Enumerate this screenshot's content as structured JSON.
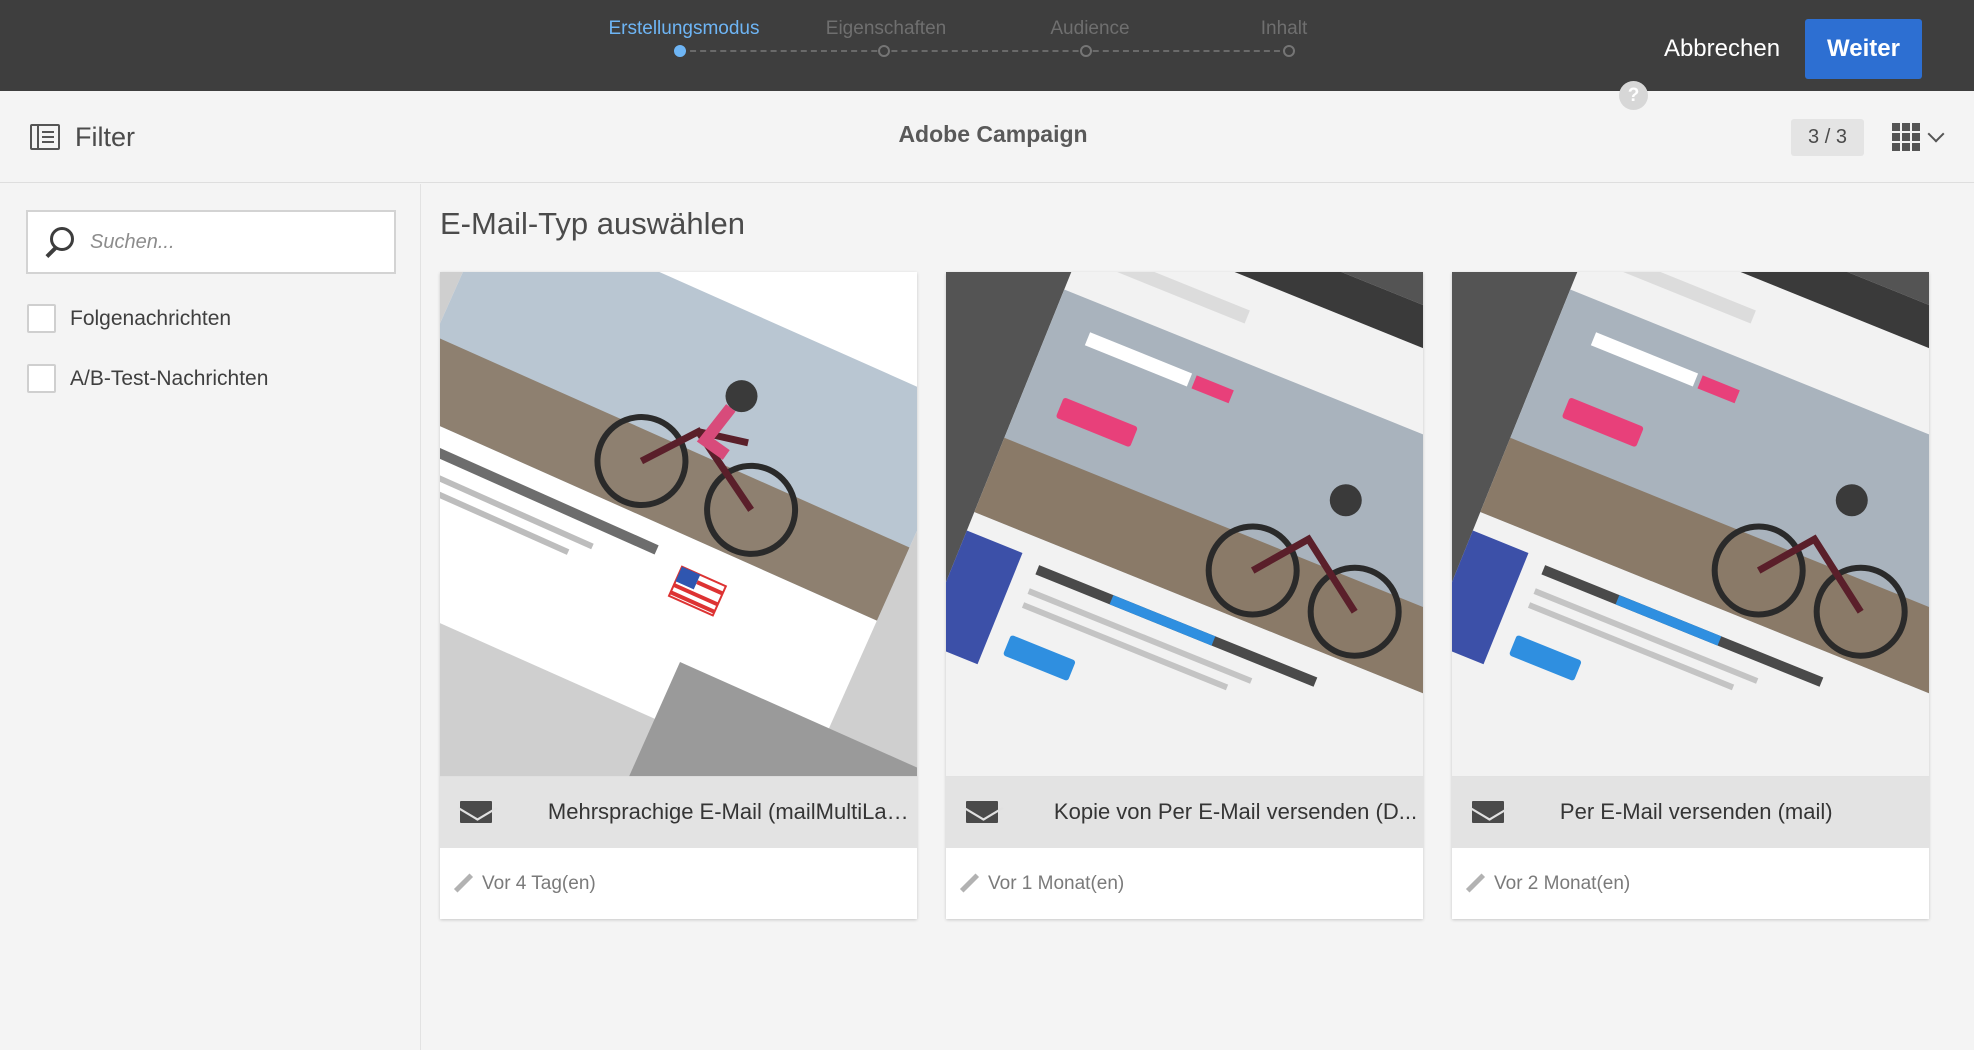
{
  "wizard": {
    "steps": [
      {
        "label": "Erstellungsmodus",
        "active": true
      },
      {
        "label": "Eigenschaften",
        "active": false
      },
      {
        "label": "Audience",
        "active": false
      },
      {
        "label": "Inhalt",
        "active": false
      }
    ],
    "cancel_label": "Abbrechen",
    "next_label": "Weiter",
    "help_label": "?"
  },
  "header": {
    "filter_label": "Filter",
    "app_title": "Adobe Campaign",
    "page_count": "3 / 3",
    "view_icon": "grid-view-icon"
  },
  "sidebar": {
    "search_placeholder": "Suchen...",
    "filters": [
      {
        "label": "Folgenachrichten",
        "checked": false
      },
      {
        "label": "A/B-Test-Nachrichten",
        "checked": false
      }
    ]
  },
  "main": {
    "title": "E-Mail-Typ auswählen",
    "cards": [
      {
        "name": "Mehrsprachige E-Mail (mailMultiLang)",
        "date": "Vor 4 Tag(en)",
        "icon": "mail-icon"
      },
      {
        "name": "Kopie von Per E-Mail versenden (D...",
        "date": "Vor 1 Monat(en)",
        "icon": "mail-icon"
      },
      {
        "name": "Per E-Mail versenden (mail)",
        "date": "Vor 2 Monat(en)",
        "icon": "mail-icon"
      }
    ]
  },
  "colors": {
    "topbar": "#3e3e3e",
    "accent": "#2d6fd2",
    "active_step": "#6eb5f5",
    "brand_pink": "#e8407a"
  }
}
